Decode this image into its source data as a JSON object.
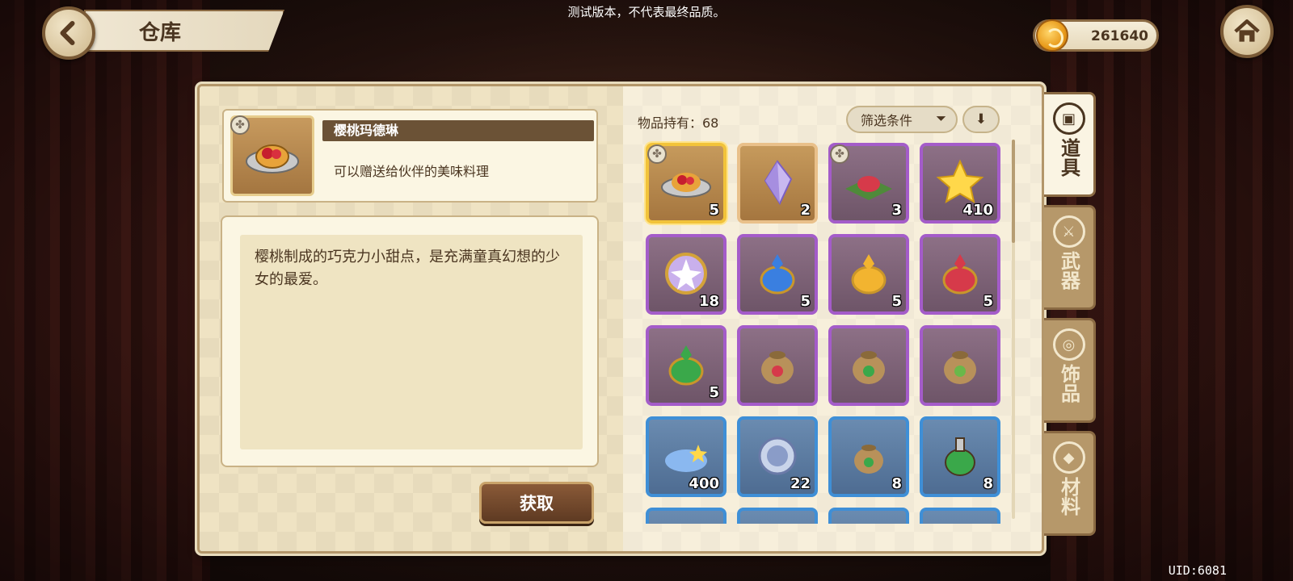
{
  "header": {
    "title": "仓库",
    "test_notice": "测试版本，不代表最终品质。"
  },
  "currency": {
    "amount": "261640",
    "icon": "gold-coin-icon"
  },
  "selected_item": {
    "name": "樱桃玛德琳",
    "subtitle": "可以赠送给伙伴的美味料理",
    "description": "樱桃制成的巧克力小甜点，是充满童真幻想的少女的最爱。",
    "get_label": "获取"
  },
  "inventory": {
    "owned_label": "物品持有：68",
    "filter_label": "筛选条件",
    "sort_icon": "arrow-down-icon",
    "items": [
      {
        "name": "cherry-madeleine",
        "rarity": "gold",
        "count": "5",
        "clover": true
      },
      {
        "name": "purple-crystal",
        "rarity": "orange",
        "count": "2",
        "clover": false
      },
      {
        "name": "strawberry-cake",
        "rarity": "purple",
        "count": "3",
        "clover": true
      },
      {
        "name": "gold-star",
        "rarity": "purple",
        "count": "410",
        "clover": false
      },
      {
        "name": "star-amulet",
        "rarity": "purple",
        "count": "18",
        "clover": false
      },
      {
        "name": "blue-potion-shield",
        "rarity": "purple",
        "count": "5",
        "clover": false
      },
      {
        "name": "gold-potion-sword",
        "rarity": "purple",
        "count": "5",
        "clover": false
      },
      {
        "name": "red-potion-heart",
        "rarity": "purple",
        "count": "5",
        "clover": false
      },
      {
        "name": "green-potion-up",
        "rarity": "purple",
        "count": "5",
        "clover": false
      },
      {
        "name": "red-pouch",
        "rarity": "purple",
        "count": "",
        "clover": false
      },
      {
        "name": "green-pouch",
        "rarity": "purple",
        "count": "",
        "clover": false
      },
      {
        "name": "leaf-pouch",
        "rarity": "purple",
        "count": "",
        "clover": false
      },
      {
        "name": "blue-crystal-dust",
        "rarity": "blue",
        "count": "400",
        "clover": false
      },
      {
        "name": "silver-coin",
        "rarity": "blue",
        "count": "22",
        "clover": false
      },
      {
        "name": "small-pouch",
        "rarity": "blue",
        "count": "8",
        "clover": false
      },
      {
        "name": "green-bottle",
        "rarity": "blue",
        "count": "8",
        "clover": false
      },
      {
        "name": "partial-1",
        "rarity": "blue",
        "count": "",
        "clover": false
      },
      {
        "name": "partial-2",
        "rarity": "blue",
        "count": "",
        "clover": false
      },
      {
        "name": "partial-3",
        "rarity": "blue",
        "count": "",
        "clover": false
      },
      {
        "name": "partial-4",
        "rarity": "blue",
        "count": "",
        "clover": false
      }
    ]
  },
  "tabs": [
    {
      "label": "道具",
      "icon": "box-icon",
      "active": true
    },
    {
      "label": "武器",
      "icon": "sword-icon",
      "active": false
    },
    {
      "label": "饰品",
      "icon": "ring-icon",
      "active": false
    },
    {
      "label": "材料",
      "icon": "ore-icon",
      "active": false
    }
  ],
  "uid": "UID:6081",
  "colors": {
    "gold": "#f2c33a",
    "purple": "#a45cc9",
    "blue": "#3f8fd6",
    "orange": "#e9c08a"
  }
}
